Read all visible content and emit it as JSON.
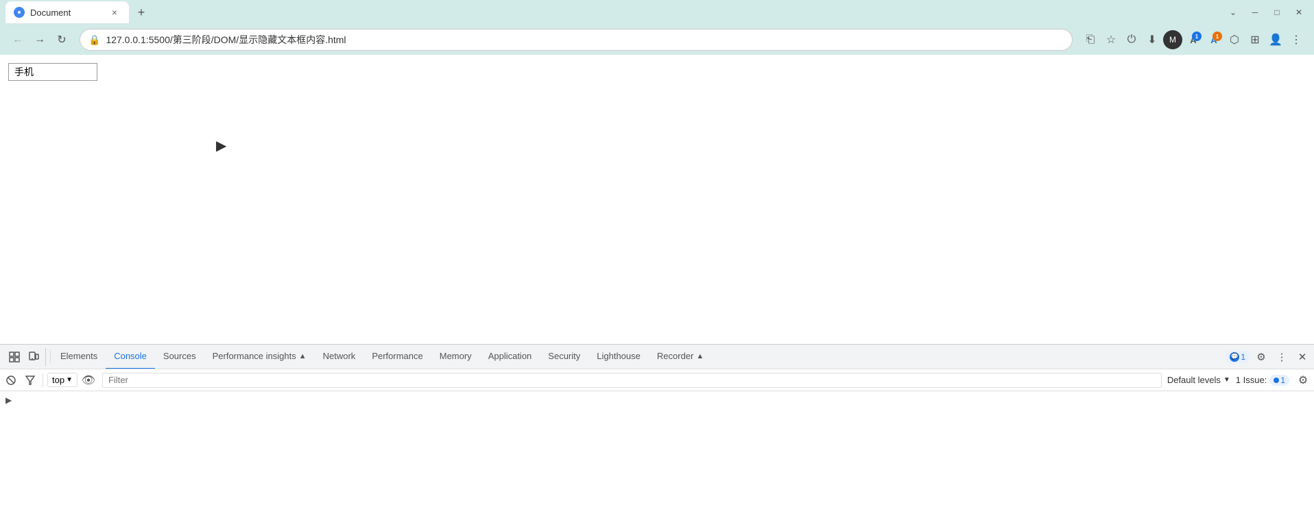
{
  "browser": {
    "tab": {
      "favicon": "●",
      "title": "Document",
      "close_label": "×"
    },
    "new_tab_label": "+",
    "window_controls": {
      "minimize": "─",
      "maximize": "□",
      "close": "✕",
      "chevron": "⌄"
    },
    "nav": {
      "back": "←",
      "forward": "→",
      "refresh": "↻"
    },
    "url": "127.0.0.1:5500/第三阶段/DOM/显示隐藏文本框内容.html",
    "toolbar": {
      "share": "⎗",
      "bookmark": "☆",
      "power": "⏻",
      "download": "⬇",
      "avatar": "👤",
      "translate": "A",
      "profile": "A",
      "puzzle": "⬡",
      "side_panel": "⊞",
      "menu": "⋮"
    }
  },
  "page": {
    "input_value": "手机",
    "input_placeholder": ""
  },
  "devtools": {
    "tabs": [
      {
        "id": "elements",
        "label": "Elements",
        "active": false
      },
      {
        "id": "console",
        "label": "Console",
        "active": true
      },
      {
        "id": "sources",
        "label": "Sources",
        "active": false
      },
      {
        "id": "performance_insights",
        "label": "Performance insights",
        "active": false,
        "has_icon": true
      },
      {
        "id": "network",
        "label": "Network",
        "active": false
      },
      {
        "id": "performance",
        "label": "Performance",
        "active": false
      },
      {
        "id": "memory",
        "label": "Memory",
        "active": false
      },
      {
        "id": "application",
        "label": "Application",
        "active": false
      },
      {
        "id": "security",
        "label": "Security",
        "active": false
      },
      {
        "id": "lighthouse",
        "label": "Lighthouse",
        "active": false
      },
      {
        "id": "recorder",
        "label": "Recorder",
        "active": false,
        "has_icon": true
      }
    ],
    "badge": {
      "label": "1",
      "icon": "💬"
    },
    "console_toolbar": {
      "top_label": "top",
      "eye_label": "👁",
      "filter_placeholder": "Filter",
      "default_levels_label": "Default levels",
      "issue_label": "1 Issue:",
      "issue_count": "1"
    }
  }
}
